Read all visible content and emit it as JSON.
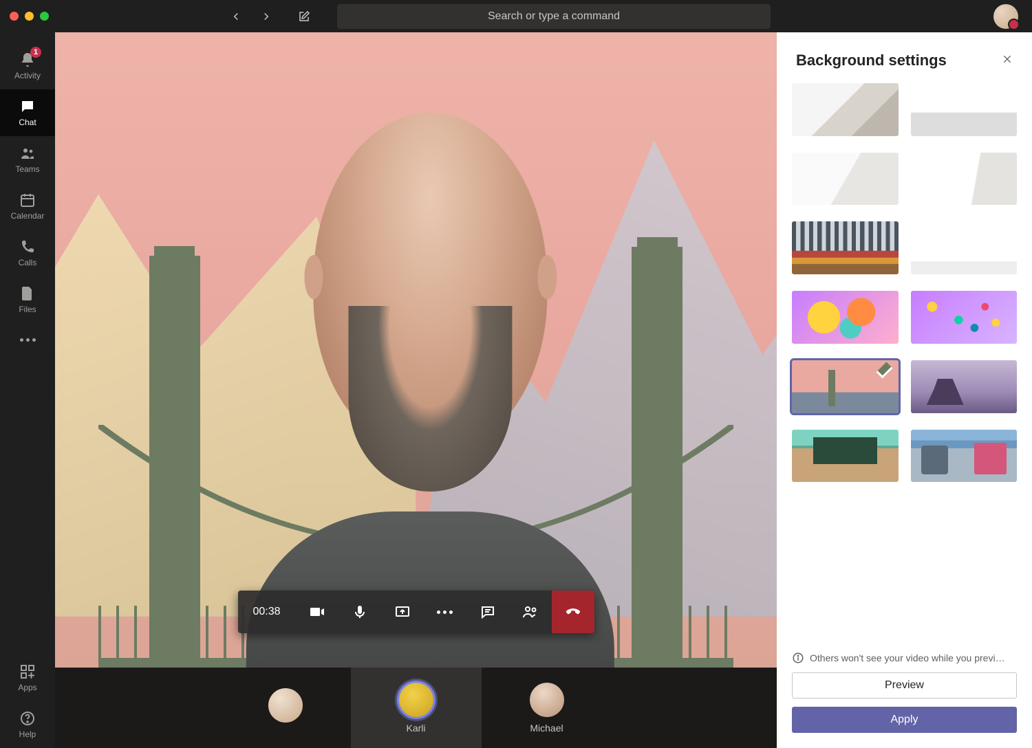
{
  "search": {
    "placeholder": "Search or type a command"
  },
  "rail": {
    "activity": {
      "label": "Activity",
      "badge": "1"
    },
    "chat": {
      "label": "Chat"
    },
    "teams": {
      "label": "Teams"
    },
    "calendar": {
      "label": "Calendar"
    },
    "calls": {
      "label": "Calls"
    },
    "files": {
      "label": "Files"
    },
    "apps": {
      "label": "Apps"
    },
    "help": {
      "label": "Help"
    }
  },
  "call": {
    "duration": "00:38"
  },
  "participants": [
    {
      "name": ""
    },
    {
      "name": "Karli"
    },
    {
      "name": "Michael"
    }
  ],
  "panel": {
    "title": "Background settings",
    "note": "Others won't see your video while you previ…",
    "preview_label": "Preview",
    "apply_label": "Apply",
    "selected_index": 8,
    "options": [
      {
        "id": "room-window-1",
        "kind": "room"
      },
      {
        "id": "room-window-2",
        "kind": "room"
      },
      {
        "id": "white-stairs",
        "kind": "room"
      },
      {
        "id": "white-gallery",
        "kind": "room"
      },
      {
        "id": "loft-colorful",
        "kind": "room"
      },
      {
        "id": "studio-plain",
        "kind": "room"
      },
      {
        "id": "abstract-balloons",
        "kind": "abstract"
      },
      {
        "id": "abstract-spheres",
        "kind": "abstract"
      },
      {
        "id": "bridge-illustration",
        "kind": "illustration"
      },
      {
        "id": "scifi-arch",
        "kind": "illustration"
      },
      {
        "id": "classroom",
        "kind": "illustration"
      },
      {
        "id": "tech-lab",
        "kind": "illustration"
      }
    ]
  }
}
